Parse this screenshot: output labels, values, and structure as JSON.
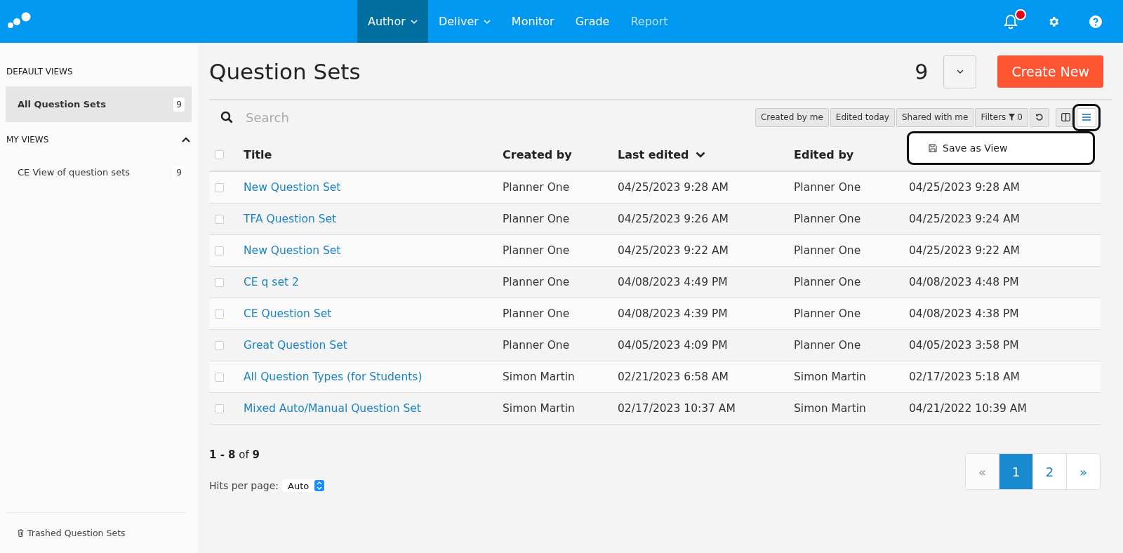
{
  "nav": {
    "items": [
      {
        "label": "Author",
        "selected": true,
        "disabled": false,
        "dropdown": true
      },
      {
        "label": "Deliver",
        "selected": false,
        "disabled": false,
        "dropdown": true
      },
      {
        "label": "Monitor",
        "selected": false,
        "disabled": false,
        "dropdown": false
      },
      {
        "label": "Grade",
        "selected": false,
        "disabled": false,
        "dropdown": false
      },
      {
        "label": "Report",
        "selected": false,
        "disabled": true,
        "dropdown": false
      }
    ],
    "notification_unread": true
  },
  "sidebar": {
    "sections": [
      {
        "heading": "DEFAULT VIEWS",
        "collapsible": false,
        "items": [
          {
            "label": "All Question Sets",
            "count": "9",
            "selected": true
          }
        ]
      },
      {
        "heading": "MY VIEWS",
        "collapsible": true,
        "items": [
          {
            "label": "CE View of question sets",
            "count": "9",
            "selected": false
          }
        ]
      }
    ],
    "footer_link": "Trashed Question Sets"
  },
  "page": {
    "title": "Question Sets",
    "count": "9",
    "create_button": "Create New"
  },
  "toolbar": {
    "search_placeholder": "Search",
    "quick_filters": [
      "Created by me",
      "Edited today",
      "Shared with me"
    ],
    "filters_label": "Filters",
    "filters_count": "0"
  },
  "menu": {
    "items": [
      "Save as View"
    ]
  },
  "table": {
    "select_all_checked": false,
    "columns": [
      {
        "label": "Title",
        "sorted": false
      },
      {
        "label": "Created by",
        "sorted": false
      },
      {
        "label": "Last edited",
        "sorted": true
      },
      {
        "label": "Edited by",
        "sorted": false
      }
    ],
    "rows": [
      {
        "checked": false,
        "title": "New Question Set",
        "created_by": "Planner One",
        "last_edited": "04/25/2023 9:28 AM",
        "edited_by": "Planner One",
        "column_5": "04/25/2023 9:28 AM"
      },
      {
        "checked": false,
        "title": "TFA Question Set",
        "created_by": "Planner One",
        "last_edited": "04/25/2023 9:26 AM",
        "edited_by": "Planner One",
        "column_5": "04/25/2023 9:24 AM"
      },
      {
        "checked": false,
        "title": "New Question Set",
        "created_by": "Planner One",
        "last_edited": "04/25/2023 9:22 AM",
        "edited_by": "Planner One",
        "column_5": "04/25/2023 9:22 AM"
      },
      {
        "checked": false,
        "title": "CE q set 2",
        "created_by": "Planner One",
        "last_edited": "04/08/2023 4:49 PM",
        "edited_by": "Planner One",
        "column_5": "04/08/2023 4:48 PM"
      },
      {
        "checked": false,
        "title": "CE Question Set",
        "created_by": "Planner One",
        "last_edited": "04/08/2023 4:39 PM",
        "edited_by": "Planner One",
        "column_5": "04/08/2023 4:38 PM"
      },
      {
        "checked": false,
        "title": "Great Question Set",
        "created_by": "Planner One",
        "last_edited": "04/05/2023 4:09 PM",
        "edited_by": "Planner One",
        "column_5": "04/05/2023 3:58 PM"
      },
      {
        "checked": false,
        "title": "All Question Types (for Students)",
        "created_by": "Simon Martin",
        "last_edited": "02/21/2023 6:58 AM",
        "edited_by": "Simon Martin",
        "column_5": "02/17/2023 5:18 AM"
      },
      {
        "checked": false,
        "title": "Mixed Auto/Manual Question Set",
        "created_by": "Simon Martin",
        "last_edited": "02/17/2023 10:37 AM",
        "edited_by": "Simon Martin",
        "column_5": "04/21/2022 10:39 AM"
      }
    ]
  },
  "summary": "**1 - 8** of **9**",
  "hits_per_page": {
    "label": "Hits per page:",
    "value": "Auto"
  },
  "pagination": {
    "prev": "«",
    "next": "»",
    "pages": [
      {
        "label": "1",
        "selected": true
      },
      {
        "label": "2",
        "selected": false
      }
    ]
  }
}
